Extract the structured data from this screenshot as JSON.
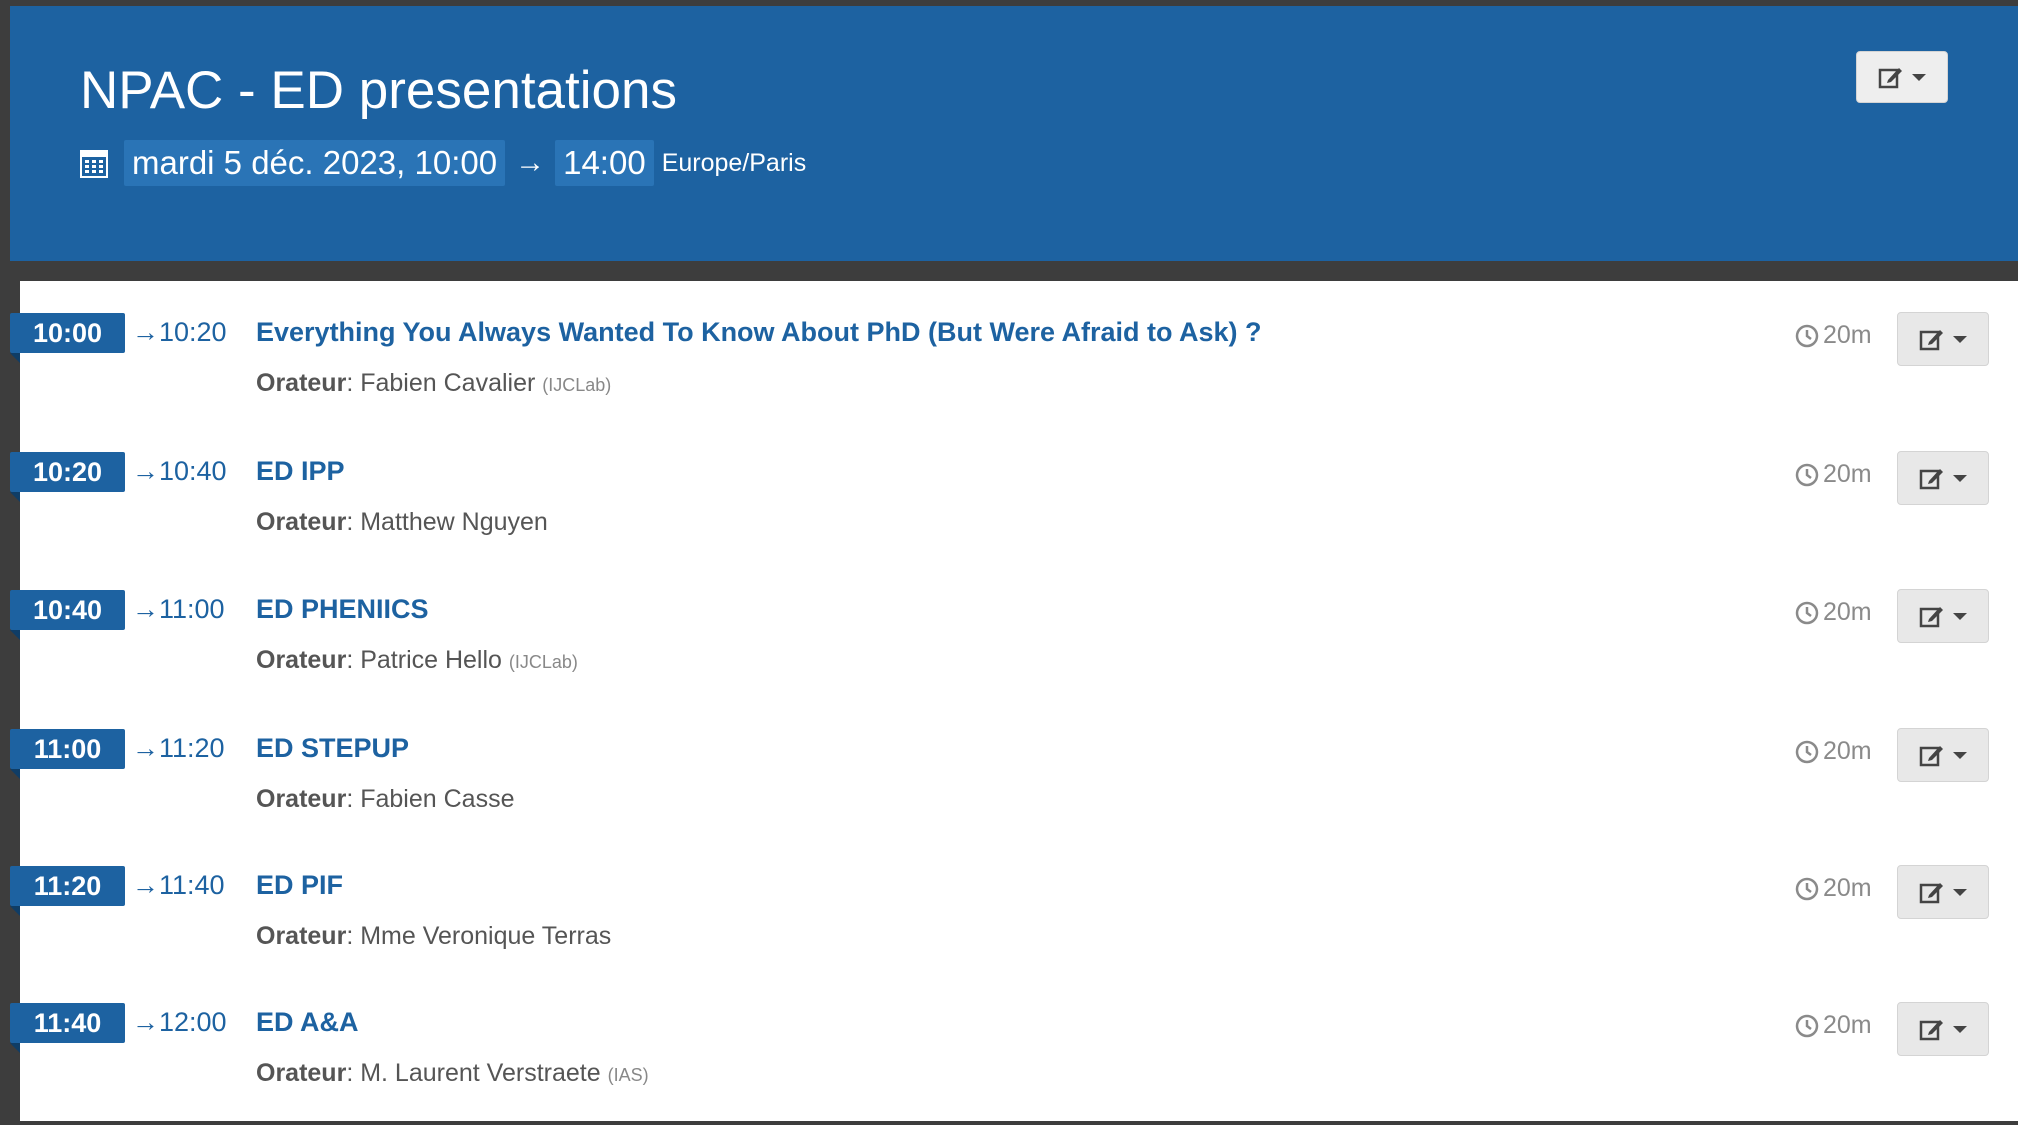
{
  "header": {
    "title": "NPAC - ED presentations",
    "start_date": "mardi 5 déc. 2023, 10:00",
    "arrow": "→",
    "end_time": "14:00",
    "timezone": "Europe/Paris",
    "bg_color": "#1d62a1"
  },
  "labels": {
    "speaker": "Orateur",
    "arrow": "→"
  },
  "entries": [
    {
      "start": "10:00",
      "end": "10:20",
      "title": "Everything You Always Wanted To Know About PhD (But Were Afraid to Ask) ?",
      "speaker": "Fabien Cavalier",
      "affiliation": "(IJCLab)",
      "duration": "20m"
    },
    {
      "start": "10:20",
      "end": "10:40",
      "title": "ED IPP",
      "speaker": "Matthew Nguyen",
      "affiliation": "",
      "duration": "20m"
    },
    {
      "start": "10:40",
      "end": "11:00",
      "title": "ED PHENIICS",
      "speaker": "Patrice Hello",
      "affiliation": "(IJCLab)",
      "duration": "20m"
    },
    {
      "start": "11:00",
      "end": "11:20",
      "title": "ED STEPUP",
      "speaker": "Fabien Casse",
      "affiliation": "",
      "duration": "20m"
    },
    {
      "start": "11:20",
      "end": "11:40",
      "title": "ED PIF",
      "speaker": "Mme Veronique Terras",
      "affiliation": "",
      "duration": "20m"
    },
    {
      "start": "11:40",
      "end": "12:00",
      "title": "ED A&A",
      "speaker": "M. Laurent Verstraete",
      "affiliation": "(IAS)",
      "duration": "20m"
    }
  ],
  "icons": {
    "calendar": "calendar-icon",
    "edit": "edit-icon",
    "clock": "clock-icon",
    "caret": "caret-down-icon"
  }
}
